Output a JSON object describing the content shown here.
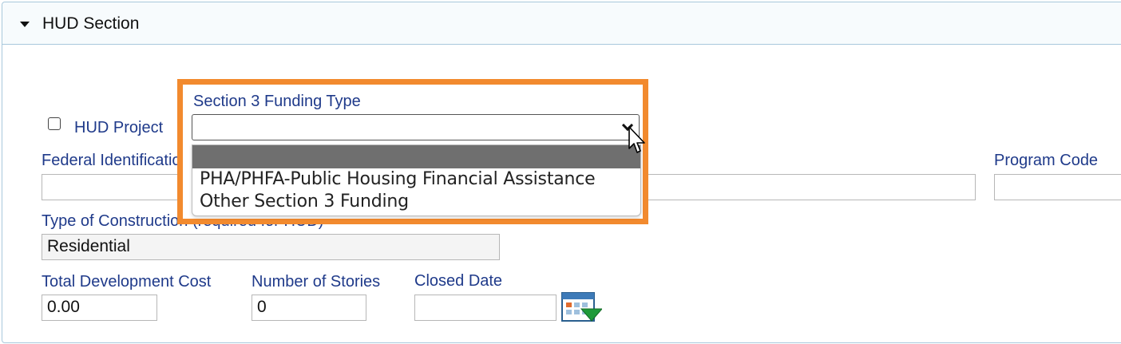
{
  "section": {
    "title": "HUD Section"
  },
  "hud_project": {
    "label": "HUD Project"
  },
  "federal_id": {
    "label": "Federal Identification",
    "value": ""
  },
  "program_code": {
    "label": "Program Code",
    "value": ""
  },
  "type_of_construction": {
    "label": "Type of Construction (required for HUD)",
    "value": "Residential"
  },
  "total_dev_cost": {
    "label": "Total Development Cost",
    "value": "0.00"
  },
  "number_of_stories": {
    "label": "Number of Stories",
    "value": "0"
  },
  "closed_date": {
    "label": "Closed Date",
    "value": ""
  },
  "section3": {
    "label": "Section 3 Funding Type",
    "selected_value": "",
    "options": [
      "",
      "PHA/PHFA-Public Housing Financial Assistance",
      "Other Section 3 Funding"
    ]
  },
  "colors": {
    "highlight": "#f28a2e",
    "label": "#1f3a8a",
    "panel_border": "#a8c8dc"
  },
  "icons": {
    "calendar": "calendar-icon",
    "caret": "caret-down-icon",
    "cursor": "mouse-pointer-icon"
  }
}
